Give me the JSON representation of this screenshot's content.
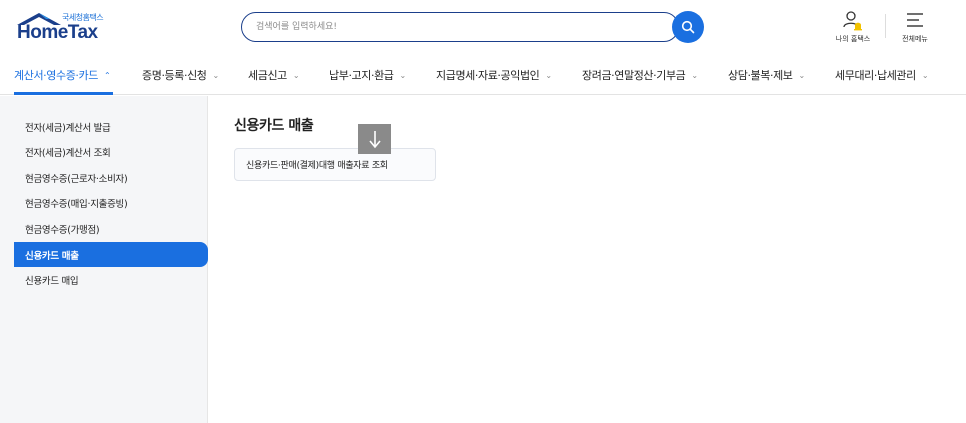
{
  "header": {
    "logo_small": "국세청홈택스",
    "logo_main": "HomeTax",
    "search_placeholder": "검색어를 입력하세요!",
    "mytax_label": "나의 홈택스",
    "allmenu_label": "전체메뉴",
    "search_button_icon": "search-icon",
    "mytax_icon": "user-bell-icon",
    "allmenu_icon": "menu-icon"
  },
  "nav": {
    "items": [
      {
        "label": "계산서·영수증·카드",
        "chevron": "⌃"
      },
      {
        "label": "증명·등록·신청",
        "chevron": "⌄"
      },
      {
        "label": "세금신고",
        "chevron": "⌄"
      },
      {
        "label": "납부·고지·환급",
        "chevron": "⌄"
      },
      {
        "label": "지급명세·자료·공익법인",
        "chevron": "⌄"
      },
      {
        "label": "장려금·연말정산·기부금",
        "chevron": "⌄"
      },
      {
        "label": "상담·불복·제보",
        "chevron": "⌄"
      },
      {
        "label": "세무대리·납세관리",
        "chevron": "⌄"
      }
    ]
  },
  "sidebar": {
    "items": [
      {
        "label": "전자(세금)계산서 발급"
      },
      {
        "label": "전자(세금)계산서 조회"
      },
      {
        "label": "현금영수증(근로자·소비자)"
      },
      {
        "label": "현금영수증(매입·지출증빙)"
      },
      {
        "label": "현금영수증(가맹점)"
      },
      {
        "label": "신용카드 매출"
      },
      {
        "label": "신용카드 매입"
      }
    ]
  },
  "main": {
    "title": "신용카드 매출",
    "cards": [
      {
        "label": "신용카드·판매(결제)대행 매출자료 조회"
      }
    ],
    "overlay_icon": "arrow-down-icon"
  },
  "colors": {
    "accent": "#1a6fe0",
    "brand_dark": "#1b3f8b"
  }
}
